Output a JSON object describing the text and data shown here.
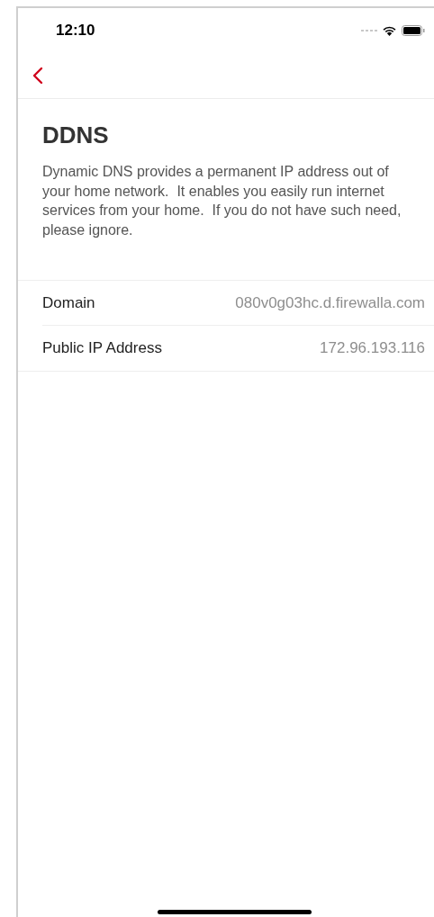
{
  "status_bar": {
    "time": "12:10"
  },
  "title": "DDNS",
  "description": "Dynamic DNS provides a permanent IP address out of your home network.  It enables you easily run internet services from your home.  If you do not have such need, please ignore.",
  "rows": [
    {
      "label": "Domain",
      "value": "080v0g03hc.d.firewalla.com"
    },
    {
      "label": "Public IP Address",
      "value": "172.96.193.116"
    }
  ]
}
